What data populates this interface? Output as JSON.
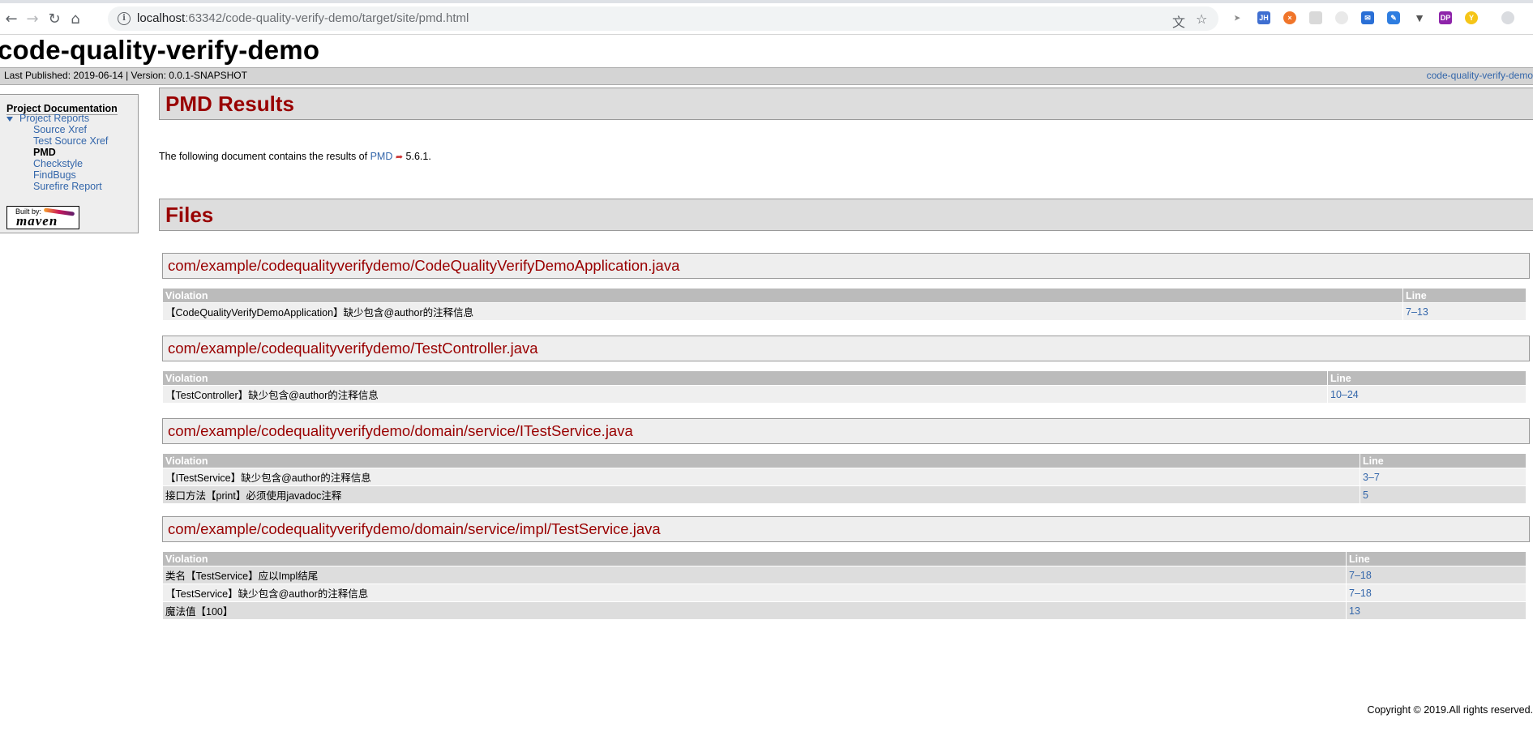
{
  "browser": {
    "url_host": "localhost",
    "url_rest": ":63342/code-quality-verify-demo/target/site/pmd.html",
    "extensions": [
      "JH",
      "DP"
    ]
  },
  "site": {
    "title": "code-quality-verify-demo",
    "published": "Last Published: 2019-06-14  | Version: 0.0.1-SNAPSHOT",
    "project_link": "code-quality-verify-demo"
  },
  "sidebar": {
    "heading": "Project Documentation",
    "group": "Project Reports",
    "items": [
      {
        "label": "Source Xref"
      },
      {
        "label": "Test Source Xref"
      },
      {
        "label": "PMD"
      },
      {
        "label": "Checkstyle"
      },
      {
        "label": "FindBugs"
      },
      {
        "label": "Surefire Report"
      }
    ],
    "badge_built_by": "Built by:",
    "badge_name": "maven"
  },
  "main": {
    "results_title": "PMD Results",
    "intro_prefix": "The following document contains the results of ",
    "intro_link": "PMD",
    "intro_suffix": " 5.6.1.",
    "files_title": "Files",
    "col_violation": "Violation",
    "col_line": "Line",
    "files": [
      {
        "path": "com/example/codequalityverifydemo/CodeQualityVerifyDemoApplication.java",
        "rows": [
          {
            "violation": "【CodeQualityVerifyDemoApplication】缺少包含@author的注释信息",
            "line": "7–13"
          }
        ]
      },
      {
        "path": "com/example/codequalityverifydemo/TestController.java",
        "rows": [
          {
            "violation": "【TestController】缺少包含@author的注释信息",
            "line": "10–24"
          }
        ]
      },
      {
        "path": "com/example/codequalityverifydemo/domain/service/ITestService.java",
        "rows": [
          {
            "violation": "【ITestService】缺少包含@author的注释信息",
            "line": "3–7"
          },
          {
            "violation": "接口方法【print】必须使用javadoc注释",
            "line": "5"
          }
        ]
      },
      {
        "path": "com/example/codequalityverifydemo/domain/service/impl/TestService.java",
        "rows": [
          {
            "violation": "类名【TestService】应以Impl结尾",
            "line": "7–18"
          },
          {
            "violation": "【TestService】缺少包含@author的注释信息",
            "line": "7–18"
          },
          {
            "violation": "魔法值【100】",
            "line": "13"
          }
        ]
      }
    ]
  },
  "footer": {
    "copyright": "Copyright © 2019.All rights reserved."
  }
}
